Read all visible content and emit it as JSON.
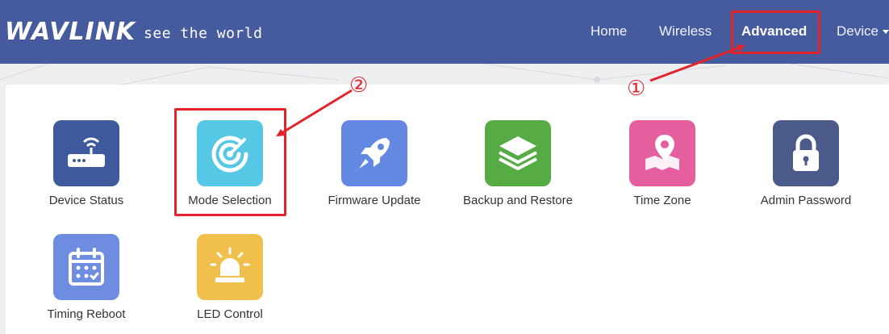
{
  "header": {
    "logo_word": "WAVLINK",
    "logo_tagline": "see the world",
    "nav": [
      {
        "label": "Home",
        "active": false
      },
      {
        "label": "Wireless",
        "active": false
      },
      {
        "label": "Advanced",
        "active": true
      },
      {
        "label": "Device",
        "active": false,
        "has_dropdown": true
      }
    ]
  },
  "tiles": [
    {
      "label": "Device Status",
      "icon": "router-icon",
      "color": "#3f5a9c"
    },
    {
      "label": "Mode Selection",
      "icon": "radar-icon",
      "color": "#56c8e6"
    },
    {
      "label": "Firmware Update",
      "icon": "rocket-icon",
      "color": "#6288e2"
    },
    {
      "label": "Backup and Restore",
      "icon": "layers-icon",
      "color": "#56ab45"
    },
    {
      "label": "Time Zone",
      "icon": "map-pin-icon",
      "color": "#e55f9e"
    },
    {
      "label": "Admin Password",
      "icon": "lock-icon",
      "color": "#4b5a88"
    },
    {
      "label": "Timing Reboot",
      "icon": "calendar-icon",
      "color": "#6e8de0"
    },
    {
      "label": "LED Control",
      "icon": "warning-light-icon",
      "color": "#f1bf4b"
    }
  ],
  "annotations": {
    "marker_1": "①",
    "marker_2": "②",
    "color": "#e3242b"
  }
}
